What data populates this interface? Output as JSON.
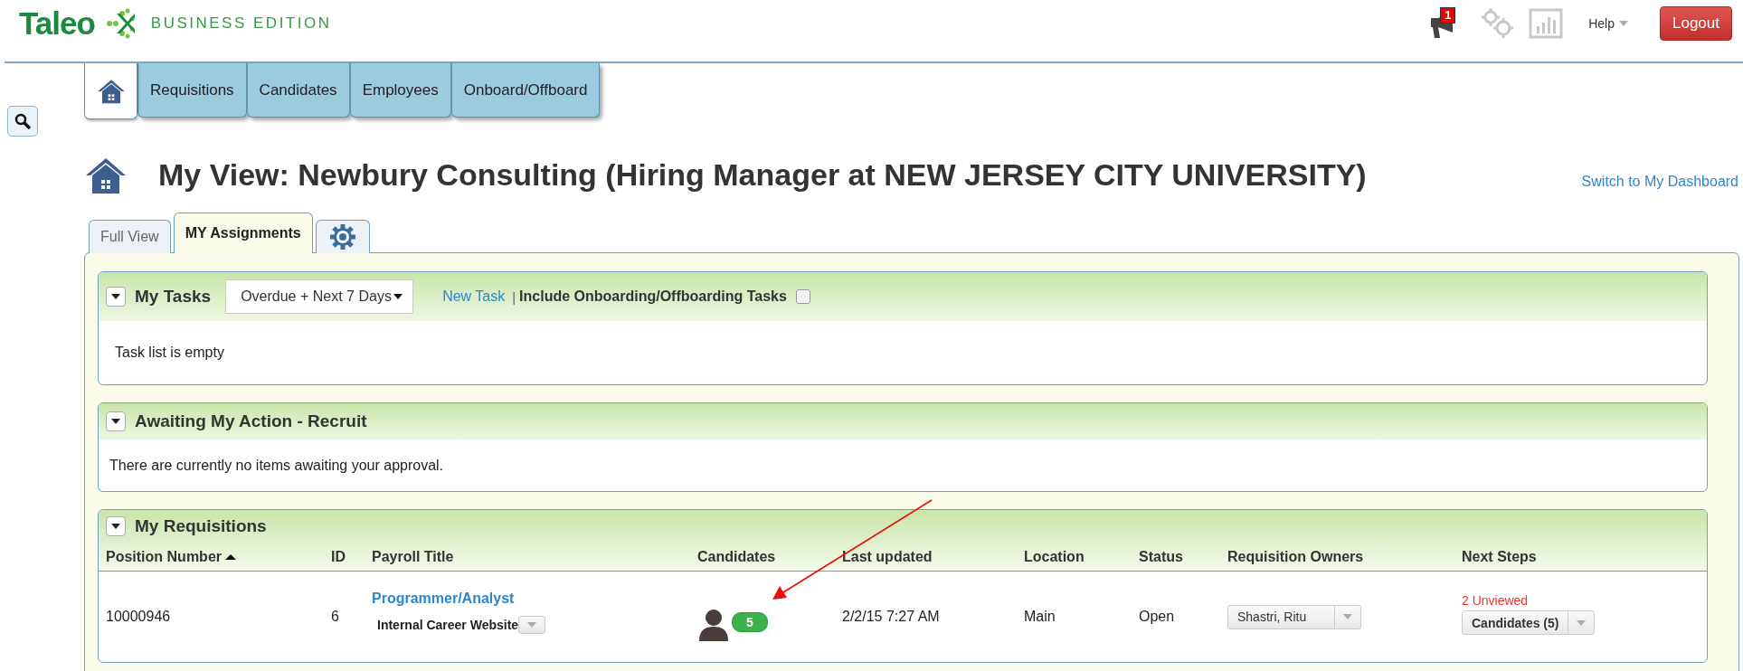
{
  "header": {
    "logo_text": "Taleo",
    "edition": "BUSINESS EDITION",
    "notification_count": "1",
    "help": "Help",
    "logout": "Logout"
  },
  "nav_tabs": [
    {
      "kind": "home",
      "selected": true
    },
    {
      "kind": "text",
      "label": "Requisitions",
      "selected": false
    },
    {
      "kind": "text",
      "label": "Candidates",
      "selected": false
    },
    {
      "kind": "text",
      "label": "Employees",
      "selected": false
    },
    {
      "kind": "text",
      "label": "Onboard/Offboard",
      "selected": false
    }
  ],
  "page": {
    "title": "My View: Newbury Consulting (Hiring Manager at NEW JERSEY CITY UNIVERSITY)",
    "switch_link": "Switch to My Dashboard"
  },
  "view_tabs": [
    {
      "kind": "text",
      "label": "Full View",
      "selected": false
    },
    {
      "kind": "text",
      "label": "MY Assignments",
      "selected": true
    },
    {
      "kind": "gear",
      "selected": false
    }
  ],
  "tasks": {
    "title": "My Tasks",
    "filter": "Overdue + Next 7 Days",
    "new_task": "New Task",
    "separator": "|",
    "include_label": "Include Onboarding/Offboarding Tasks",
    "include_checked": false,
    "empty_message": "Task list is empty"
  },
  "awaiting": {
    "title": "Awaiting My Action - Recruit",
    "message": "There are currently no items awaiting your approval."
  },
  "requisitions": {
    "title": "My Requisitions",
    "columns": [
      {
        "label": "Position Number",
        "sorted": true
      },
      {
        "label": "ID",
        "sorted": false
      },
      {
        "label": "Payroll Title",
        "sorted": false
      },
      {
        "label": "Candidates",
        "sorted": false
      },
      {
        "label": "Last updated",
        "sorted": false
      },
      {
        "label": "Location",
        "sorted": false
      },
      {
        "label": "Status",
        "sorted": false
      },
      {
        "label": "Requisition Owners",
        "sorted": false
      },
      {
        "label": "Next Steps",
        "sorted": false
      }
    ],
    "rows": [
      {
        "position_number": "10000946",
        "id": "6",
        "payroll_title": "Programmer/Analyst",
        "posting": "Internal Career Website",
        "candidate_count": "5",
        "last_updated": "2/2/15 7:27 AM",
        "location": "Main",
        "status": "Open",
        "owner": "Shastri, Ritu",
        "unviewed": "2 Unviewed",
        "next_step": "Candidates (5)"
      }
    ]
  }
}
